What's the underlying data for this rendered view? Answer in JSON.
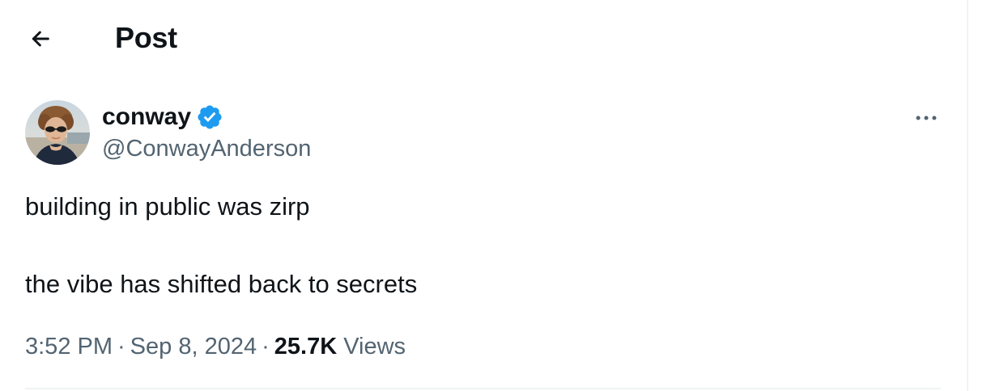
{
  "header": {
    "back_icon": "arrow-left-icon",
    "title": "Post"
  },
  "author": {
    "display_name": "conway",
    "handle": "@ConwayAnderson",
    "verified": true,
    "verified_icon": "verified-badge-icon",
    "avatar_icon": "avatar-photo"
  },
  "menu": {
    "icon": "more-horizontal-icon"
  },
  "tweet": {
    "lines": [
      "building in public was zirp",
      "the vibe has shifted back to secrets"
    ]
  },
  "meta": {
    "time": "3:52 PM",
    "separator": "·",
    "date": "Sep 8, 2024",
    "views_count": "25.7K",
    "views_label": "Views"
  },
  "colors": {
    "text": "#0f1419",
    "secondary": "#536471",
    "verified": "#1d9bf0",
    "divider": "#eff3f4"
  }
}
